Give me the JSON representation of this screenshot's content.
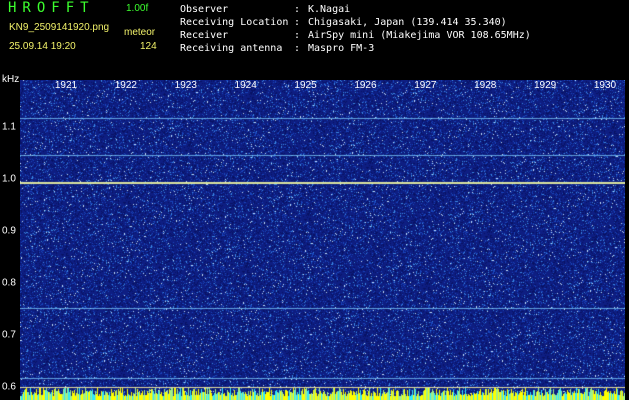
{
  "header": {
    "app_title": "HROFFT",
    "version": "1.00f",
    "filename": "KN9_2509141920.png",
    "meteor_label": "meteor",
    "datetime": "25.09.14 19:20",
    "meteor_count": "124"
  },
  "info": [
    {
      "key": "Observer",
      "sep": ":",
      "value": "K.Nagai"
    },
    {
      "key": "Receiving Location",
      "sep": ":",
      "value": "Chigasaki, Japan (139.414 35.340)"
    },
    {
      "key": "Receiver",
      "sep": ":",
      "value": "AirSpy mini (Miakejima VOR 108.65MHz)"
    },
    {
      "key": "Receiving antenna",
      "sep": ":",
      "value": "Maspro FM-3"
    }
  ],
  "colors": {
    "title_green": "#3cff2e",
    "meta_yellow": "#f2f26a",
    "background": "#000000",
    "noise_base": "#0d1d8a",
    "signal_line": "#7fd0ff",
    "carrier_line": "#e8f0a0",
    "bottom_band": "#ffff00"
  },
  "chart_data": {
    "type": "heatmap",
    "xlabel": "",
    "ylabel": "kHz",
    "x_ticks": [
      "1921",
      "1922",
      "1923",
      "1924",
      "1925",
      "1926",
      "1927",
      "1928",
      "1929",
      "1930"
    ],
    "y_ticks": [
      "1.1",
      "1.0",
      "0.9",
      "0.8",
      "0.7",
      "0.6"
    ],
    "ylim": [
      0.59,
      1.19
    ],
    "horizontal_lines_khz": [
      1.117,
      1.045,
      0.993,
      0.752,
      0.617
    ],
    "grid": false
  }
}
